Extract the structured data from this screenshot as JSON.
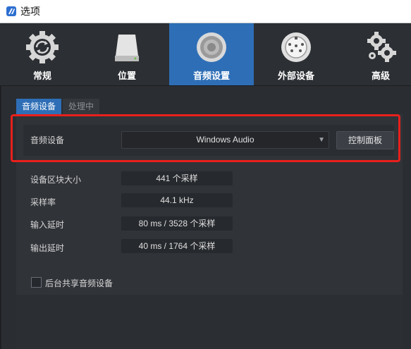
{
  "window": {
    "title": "选项"
  },
  "toolbar": {
    "items": [
      {
        "label": "常规",
        "icon": "refresh-gear-icon",
        "active": false
      },
      {
        "label": "位置",
        "icon": "hard-drive-icon",
        "active": false
      },
      {
        "label": "音频设置",
        "icon": "speaker-icon",
        "active": true
      },
      {
        "label": "外部设备",
        "icon": "midi-port-icon",
        "active": false
      },
      {
        "label": "高级",
        "icon": "gears-icon",
        "active": false
      }
    ]
  },
  "tabs": [
    {
      "label": "音频设备",
      "active": true
    },
    {
      "label": "处理中",
      "active": false
    }
  ],
  "device": {
    "label": "音频设备",
    "selected": "Windows Audio",
    "control_panel_button": "控制面板"
  },
  "settings": [
    {
      "label": "设备区块大小",
      "value": "441 个采样"
    },
    {
      "label": "采样率",
      "value": "44.1 kHz"
    },
    {
      "label": "输入延时",
      "value": "80 ms / 3528 个采样"
    },
    {
      "label": "输出延时",
      "value": "40 ms / 1764 个采样"
    }
  ],
  "share_checkbox": {
    "label": "后台共享音频设备",
    "checked": false
  },
  "colors": {
    "accent": "#2e6eb6",
    "highlight": "#e8201c",
    "background": "#25282c"
  }
}
